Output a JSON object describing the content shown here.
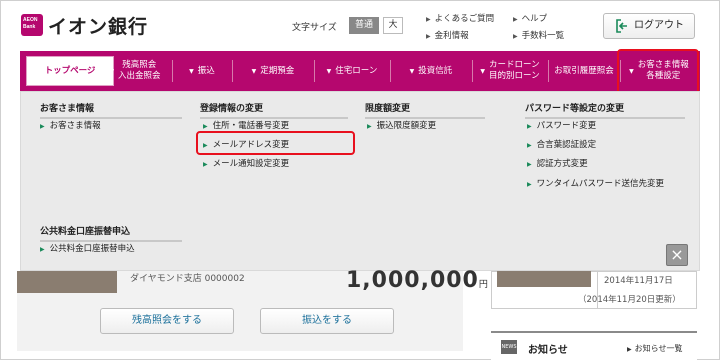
{
  "header": {
    "logo_mark": "AEON Bank",
    "bank_name": "イオン銀行",
    "font_size_label": "文字サイズ",
    "font_normal": "普通",
    "font_large": "大",
    "links": [
      "よくあるご質問",
      "金利情報",
      "ヘルプ",
      "手数料一覧"
    ],
    "logout": "ログアウト"
  },
  "nav": {
    "items": [
      "トップページ",
      "残高照会\n入出金照会",
      "振込",
      "定期預金",
      "住宅ローン",
      "投資信託",
      "カードローン\n目的別ローン",
      "お取引履歴照会",
      "お客さま情報\n各種設定"
    ]
  },
  "panel": {
    "sections": [
      {
        "title": "お客さま情報",
        "links": [
          "お客さま情報"
        ]
      },
      {
        "title": "登録情報の変更",
        "links": [
          "住所・電話番号変更",
          "メールアドレス変更",
          "メール通知設定変更"
        ]
      },
      {
        "title": "限度額変更",
        "links": [
          "振込限度額変更"
        ]
      },
      {
        "title": "パスワード等設定の変更",
        "links": [
          "パスワード変更",
          "合言葉認証設定",
          "認証方式変更",
          "ワンタイムパスワード送信先変更"
        ]
      },
      {
        "title": "公共料金口座振替申込",
        "links": [
          "公共料金口座振替申込"
        ]
      }
    ],
    "close": "×"
  },
  "below": {
    "account_text": "ダイヤモンド支店 0000002",
    "amount": "1,000,000",
    "yen": "円",
    "buttons": [
      "残高照会をする",
      "振込をする"
    ],
    "right_date1": "2014年11月17日",
    "right_date2": "（2014年11月20日更新）",
    "news_icon": "NEWS",
    "news_title": "お知らせ",
    "news_list": "お知らせ一覧"
  },
  "colors": {
    "brand": "#b5076e",
    "highlight": "#e8101e",
    "link_arrow": "#1a8a5a"
  }
}
